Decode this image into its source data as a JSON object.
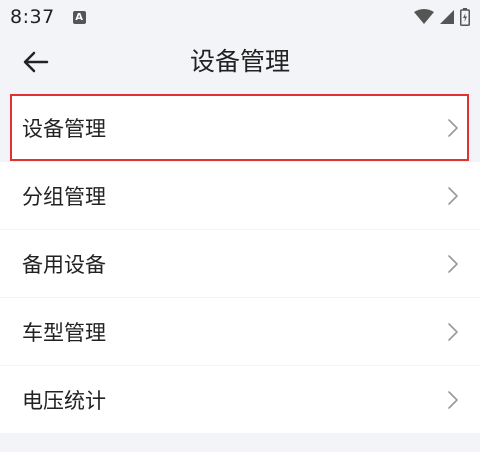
{
  "status_bar": {
    "time": "8:37",
    "notification_icon": "A",
    "icons": [
      "wifi-icon",
      "signal-icon",
      "battery-icon"
    ]
  },
  "header": {
    "title": "设备管理",
    "back_icon": "arrow-left-icon"
  },
  "menu": {
    "items": [
      {
        "label": "设备管理",
        "selected": true
      },
      {
        "label": "分组管理"
      },
      {
        "label": "备用设备"
      },
      {
        "label": "车型管理"
      },
      {
        "label": "电压统计"
      }
    ]
  },
  "colors": {
    "background": "#f2f4f7",
    "item_background": "#ffffff",
    "selection_outline": "#e03232",
    "chevron": "#999999"
  }
}
